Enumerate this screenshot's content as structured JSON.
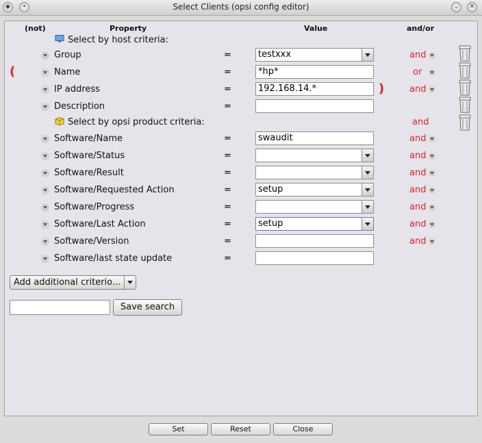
{
  "window": {
    "title": "Select Clients (opsi config editor)"
  },
  "headers": {
    "not": "(not)",
    "property": "Property",
    "value": "Value",
    "andor": "and/or"
  },
  "groups": {
    "host": "Select by host criteria:",
    "product": "Select by opsi product criteria:",
    "product_andor": "and"
  },
  "rows": [
    {
      "property": "Group",
      "eq": "=",
      "value": "testxxx",
      "andor": "and"
    },
    {
      "property": "Name",
      "eq": "=",
      "value": "*hp*",
      "andor": "or",
      "open_paren": "("
    },
    {
      "property": "IP address",
      "eq": "=",
      "value": "192.168.14.*",
      "andor": "and",
      "close_paren": ")"
    },
    {
      "property": "Description",
      "eq": "=",
      "value": ""
    },
    {
      "property": "Software/Name",
      "eq": "=",
      "value": "swaudit",
      "andor": "and"
    },
    {
      "property": "Software/Status",
      "eq": "=",
      "value": "",
      "andor": "and"
    },
    {
      "property": "Software/Result",
      "eq": "=",
      "value": "",
      "andor": "and"
    },
    {
      "property": "Software/Requested Action",
      "eq": "=",
      "value": "setup",
      "andor": "and"
    },
    {
      "property": "Software/Progress",
      "eq": "=",
      "value": "",
      "andor": "and"
    },
    {
      "property": "Software/Last Action",
      "eq": "=",
      "value": "setup",
      "andor": "and"
    },
    {
      "property": "Software/Version",
      "eq": "=",
      "value": "",
      "andor": "and"
    },
    {
      "property": "Software/last state update",
      "eq": "=",
      "value": ""
    }
  ],
  "add_criterion": {
    "label": "Add additional criterio..."
  },
  "save": {
    "input_value": "",
    "button_label": "Save search"
  },
  "footer": {
    "set": "Set",
    "reset": "Reset",
    "close": "Close"
  }
}
